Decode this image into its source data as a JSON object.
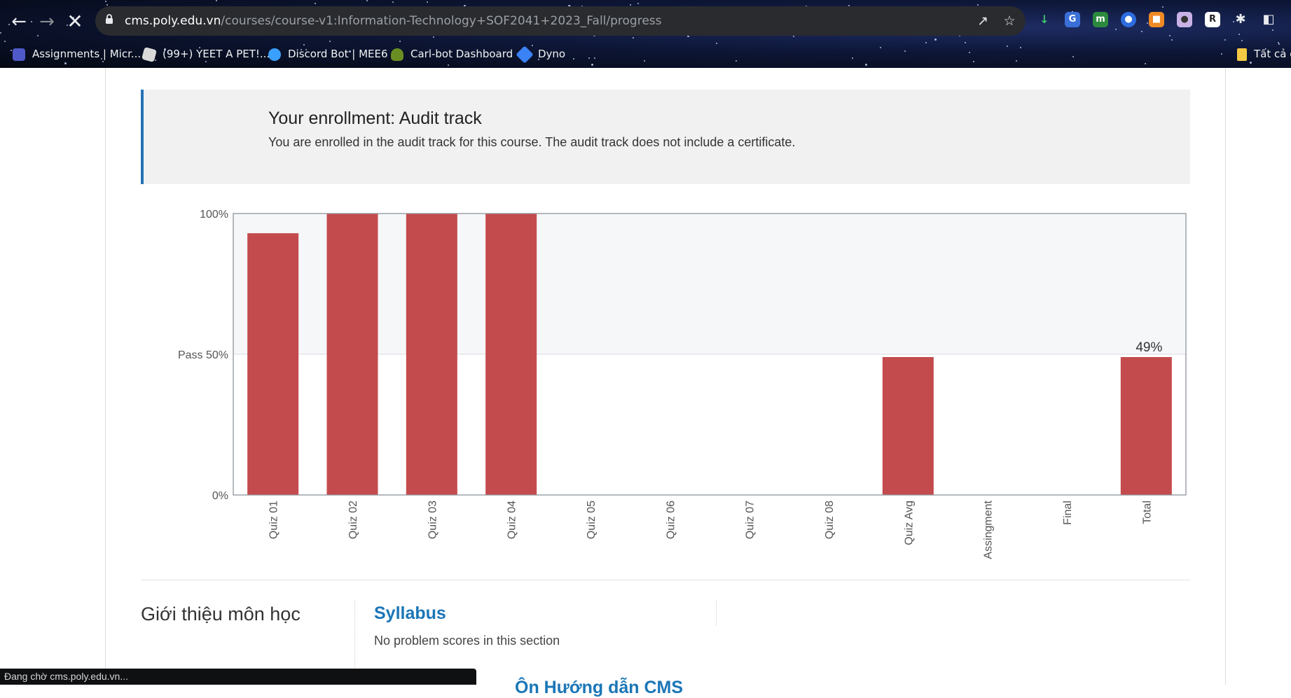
{
  "browser": {
    "url_host": "cms.poly.edu.vn",
    "url_path": "/courses/course-v1:Information-Technology+SOF2041+2023_Fall/progress",
    "bookmarks": [
      {
        "label": "Assignments | Micr...",
        "icon": "teams-icon",
        "color": "#5059c9"
      },
      {
        "label": "(99+) YEET A PET!...",
        "icon": "roblox-icon",
        "color": "#d9d9d9"
      },
      {
        "label": "Discord Bot | MEE6",
        "icon": "mee6-icon",
        "color": "#3aa0ff"
      },
      {
        "label": "Carl-bot Dashboard",
        "icon": "carlbot-icon",
        "color": "#6b8e23"
      },
      {
        "label": "Dyno",
        "icon": "dyno-icon",
        "color": "#3b82f6"
      }
    ],
    "bookmark_right": "Tất cả d",
    "status_text": "Đang chờ cms.poly.edu.vn..."
  },
  "enrollment": {
    "title": "Your enrollment: Audit track",
    "message": "You are enrolled in the audit track for this course. The audit track does not include a certificate."
  },
  "chart_data": {
    "type": "bar",
    "categories": [
      "Quiz 01",
      "Quiz 02",
      "Quiz 03",
      "Quiz 04",
      "Quiz 05",
      "Quiz 06",
      "Quiz 07",
      "Quiz 08",
      "Quiz Avg",
      "Assingment",
      "Final",
      "Total"
    ],
    "values": [
      93,
      100,
      100,
      100,
      0,
      0,
      0,
      0,
      49,
      0,
      0,
      49
    ],
    "y_ticks": [
      "0%",
      "Pass 50%",
      "100%"
    ],
    "y_tick_values": [
      0,
      50,
      100
    ],
    "ylim": [
      0,
      100
    ],
    "data_labels": [
      {
        "category": "Total",
        "text": "49%"
      }
    ],
    "bar_color": "#c44b4d",
    "pass_region_color": "#f6f7f9"
  },
  "section": {
    "title": "Giới thiệu môn học",
    "subsection_title": "Syllabus",
    "subsection_note": "No problem scores in this section",
    "next_title": "Ôn Hướng dẫn CMS"
  }
}
